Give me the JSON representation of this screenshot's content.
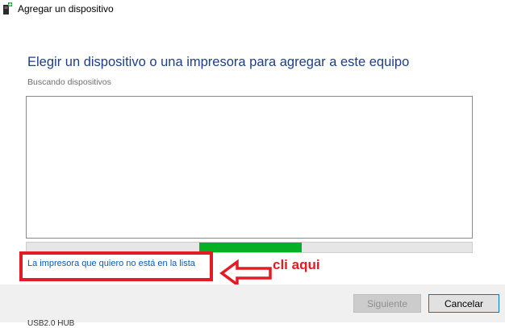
{
  "window": {
    "title": "Agregar un dispositivo",
    "icon": "add-device-icon"
  },
  "main": {
    "heading": "Elegir un dispositivo o una impresora para agregar a este equipo",
    "status": "Buscando dispositivos",
    "progress_percent": 33,
    "link": "La impresora que quiero no está en la lista"
  },
  "annotation": {
    "text": "cli aqui",
    "color": "#e31b23",
    "arrow_icon": "left-arrow-icon"
  },
  "footer": {
    "next_label": "Siguiente",
    "cancel_label": "Cancelar"
  },
  "background": {
    "partial_text": "USB2.0 HUB"
  }
}
